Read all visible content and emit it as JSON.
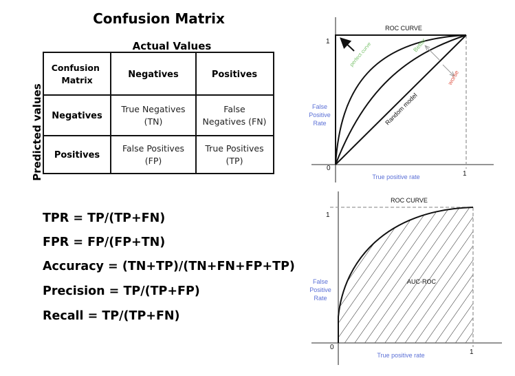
{
  "confusion_matrix": {
    "title": "Confusion Matrix",
    "actual_label": "Actual Values",
    "predicted_label": "Predicted values",
    "corner": [
      "Confusion",
      "Matrix"
    ],
    "col_headers": [
      "Negatives",
      "Positives"
    ],
    "row_headers": [
      "Negatives",
      "Positives"
    ],
    "cells": [
      [
        [
          "True Negatives",
          "(TN)"
        ],
        [
          "False",
          "Negatives (FN)"
        ]
      ],
      [
        [
          "False Positives",
          "(FP)"
        ],
        [
          "True Positives",
          "(TP)"
        ]
      ]
    ]
  },
  "formulas": [
    "TPR = TP/(TP+FN)",
    "FPR = FP/(FP+TN)",
    "Accuracy = (TN+TP)/(TN+FN+FP+TP)",
    "Precision = TP/(TP+FP)",
    "Recall = TP/(TP+FN)"
  ],
  "roc_top": {
    "title": "ROC CURVE",
    "y_label": [
      "False",
      "Positive",
      "Rate"
    ],
    "x_label": "True positive rate",
    "y_tick_1": "1",
    "origin": "0",
    "x_tick_1": "1",
    "perfect_curve": "perfect curve",
    "better": "Better",
    "worse": "worse",
    "random_model": "Random model"
  },
  "roc_bottom": {
    "title": "ROC CURVE",
    "area_label": "AUC-ROC",
    "y_label": [
      "False",
      "Positive",
      "Rate"
    ],
    "x_label": "True positive rate",
    "y_tick_1": "1",
    "origin": "0",
    "x_tick_1": "1"
  },
  "colors": {
    "axis_label": "#5a6fd6",
    "better": "#7cc36e",
    "worse": "#e05a4a"
  }
}
